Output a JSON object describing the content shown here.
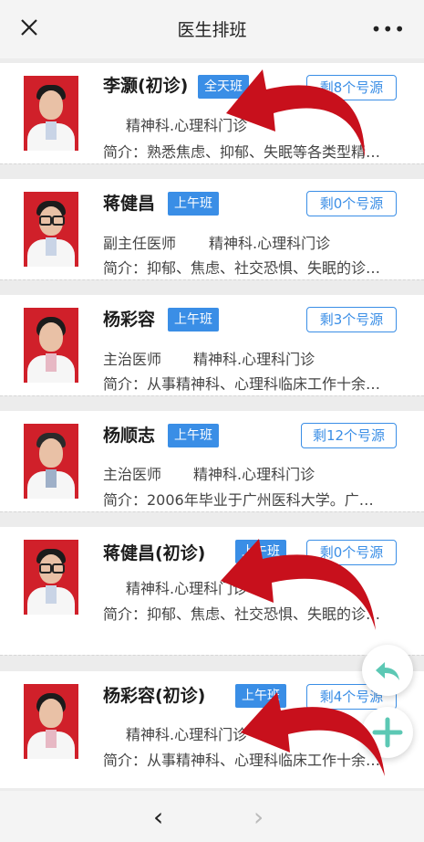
{
  "header": {
    "title": "医生排班",
    "close_icon": "close-icon",
    "more_label": "•••"
  },
  "doctors": [
    {
      "name": "李灏(初诊)",
      "shift": "全天班",
      "quota": "剩8个号源",
      "title": "",
      "dept": "精神科.心理科门诊",
      "intro": "简介：熟悉焦虑、抑郁、失眠等各类型精…"
    },
    {
      "name": "蒋健昌",
      "shift": "上午班",
      "quota": "剩0个号源",
      "title": "副主任医师",
      "dept": "精神科.心理科门诊",
      "intro": "简介：抑郁、焦虑、社交恐惧、失眠的诊…"
    },
    {
      "name": "杨彩容",
      "shift": "上午班",
      "quota": "剩3个号源",
      "title": "主治医师",
      "dept": "精神科.心理科门诊",
      "intro": "简介：从事精神科、心理科临床工作十余…"
    },
    {
      "name": "杨顺志",
      "shift": "上午班",
      "quota": "剩12个号源",
      "title": "主治医师",
      "dept": "精神科.心理科门诊",
      "intro": "简介：2006年毕业于广州医科大学。广…"
    },
    {
      "name": "蒋健昌(初诊)",
      "shift": "上午班",
      "quota": "剩0个号源",
      "title": "",
      "dept": "精神科.心理科门诊",
      "intro": "简介：抑郁、焦虑、社交恐惧、失眠的诊…"
    },
    {
      "name": "杨彩容(初诊)",
      "shift": "上午班",
      "quota": "剩4个号源",
      "title": "",
      "dept": "精神科.心理科门诊",
      "intro": "简介：从事精神科、心理科临床工作十余…"
    }
  ],
  "nav": {
    "back": "‹",
    "forward": "›"
  },
  "fabs": {
    "reply_icon": "reply-arrow-icon",
    "add_icon": "plus-icon"
  },
  "colors": {
    "accent": "#3a8ee6",
    "photo_bg": "#d0202a",
    "arrow": "#c8101c",
    "fab_icon": "#5cc8b4"
  }
}
